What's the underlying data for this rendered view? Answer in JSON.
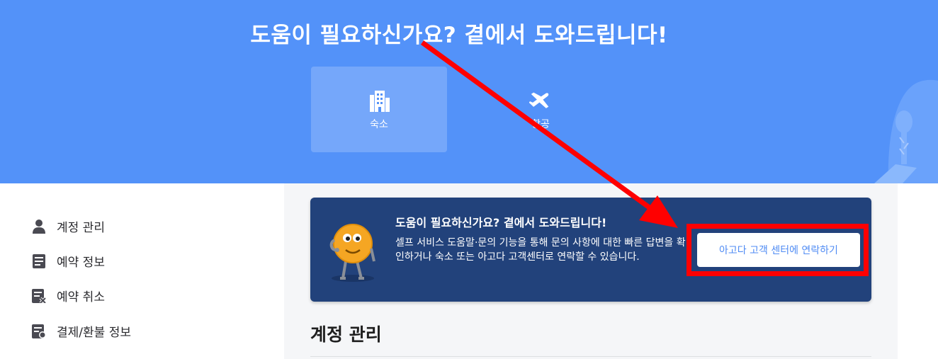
{
  "hero": {
    "title": "도움이 필요하신가요? 곁에서 도와드립니다!",
    "tabs": [
      {
        "label": "숙소",
        "icon": "building-icon",
        "active": true
      },
      {
        "label": "항공",
        "icon": "airplane-icon",
        "active": false
      }
    ]
  },
  "sidebar": {
    "items": [
      {
        "label": "계정 관리",
        "icon": "person-icon"
      },
      {
        "label": "예약 정보",
        "icon": "document-icon"
      },
      {
        "label": "예약 취소",
        "icon": "document-cancel-icon"
      },
      {
        "label": "결제/환불 정보",
        "icon": "document-payment-icon"
      }
    ]
  },
  "banner": {
    "title": "도움이 필요하신가요? 곁에서 도와드립니다!",
    "text": "셀프 서비스 도움말·문의 기능을 통해 문의 사항에 대한 빠른 답변을 확인하거나 숙소 또는 아고다 고객센터로 연락할 수 있습니다.",
    "button_label": "아고다 고객 센터에 연락하기"
  },
  "section": {
    "title": "계정 관리"
  },
  "colors": {
    "hero_bg": "#5392f9",
    "banner_bg": "#22427b",
    "button_text": "#4f8bf4",
    "annotation": "#ff0000"
  }
}
